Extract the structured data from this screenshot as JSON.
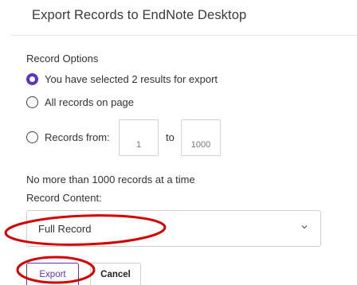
{
  "dialog": {
    "title": "Export Records to EndNote Desktop"
  },
  "record_options": {
    "label": "Record Options",
    "options": [
      {
        "label": "You have selected 2 results for export",
        "checked": true
      },
      {
        "label": "All records on page",
        "checked": false
      },
      {
        "label": "Records from:",
        "checked": false
      }
    ],
    "range": {
      "from_placeholder": "1",
      "to_label": "to",
      "to_placeholder": "1000"
    },
    "limit_note": "No more than 1000 records at a time"
  },
  "record_content": {
    "label": "Record Content:",
    "selected": "Full Record"
  },
  "actions": {
    "export_label": "Export",
    "cancel_label": "Cancel"
  },
  "colors": {
    "accent": "#5e33bf",
    "annotation": "#d40000"
  },
  "icons": {
    "dropdown": "chevron-down-icon"
  }
}
